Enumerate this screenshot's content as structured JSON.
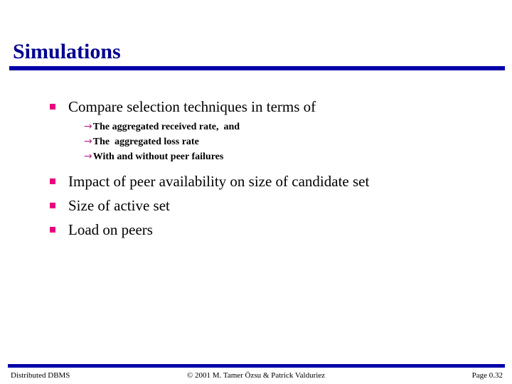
{
  "slide": {
    "title": "Simulations",
    "accent_color": "#0000a8",
    "title_color": "#00008f",
    "bullet_color": "#e8007d",
    "arrow_color": "#b0308c",
    "background": "#ffffff"
  },
  "content": {
    "bullets": [
      {
        "text": "Compare selection techniques in terms of",
        "sub": [
          {
            "marker": "→",
            "text": "The aggregated received rate,  and"
          },
          {
            "marker": "→",
            "text": "The  aggregated loss rate"
          },
          {
            "marker": "→",
            "text": "With and without peer failures"
          }
        ]
      },
      {
        "text": "Impact of peer availability on size of candidate set",
        "sub": []
      },
      {
        "text": "Size of active set",
        "sub": []
      },
      {
        "text": "Load on peers",
        "sub": []
      }
    ]
  },
  "footer": {
    "left": "Distributed DBMS",
    "center": "© 2001 M. Tamer Özsu & Patrick Valduriez",
    "right": "Page 0.32"
  }
}
